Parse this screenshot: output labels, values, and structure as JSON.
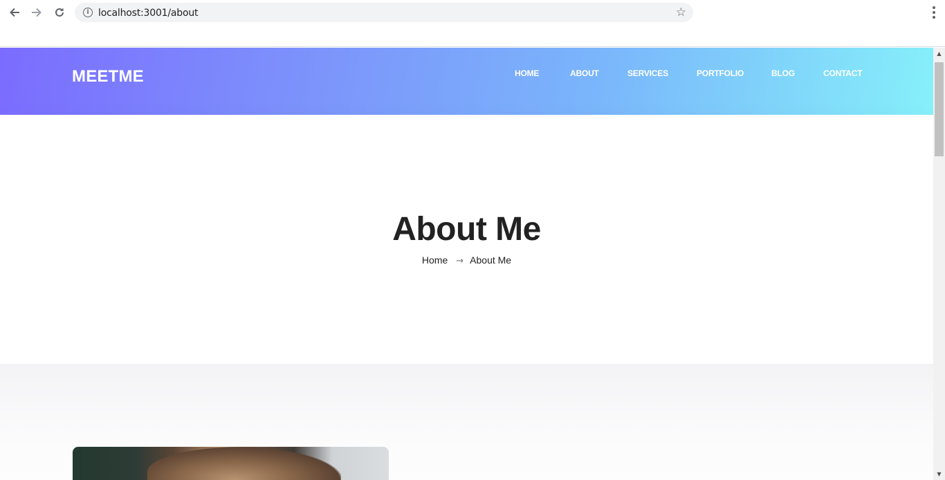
{
  "browser": {
    "url": "localhost:3001/about",
    "back_icon": "arrow-left-icon",
    "forward_icon": "arrow-right-icon",
    "reload_icon": "reload-icon",
    "info_icon": "info-icon",
    "bookmark_icon": "star-icon",
    "menu_icon": "more-vert-icon"
  },
  "site": {
    "logo": "MEETME",
    "nav": [
      "HOME",
      "ABOUT",
      "SERVICES",
      "PORTFOLIO",
      "BLOG",
      "CONTACT"
    ],
    "header_gradient": [
      "#7b6cff",
      "#86f0fa"
    ]
  },
  "hero": {
    "title": "About Me",
    "breadcrumb": {
      "home": "Home",
      "current": "About Me"
    }
  },
  "colors": {
    "heading": "#222222",
    "nav_text": "#ffffff"
  }
}
